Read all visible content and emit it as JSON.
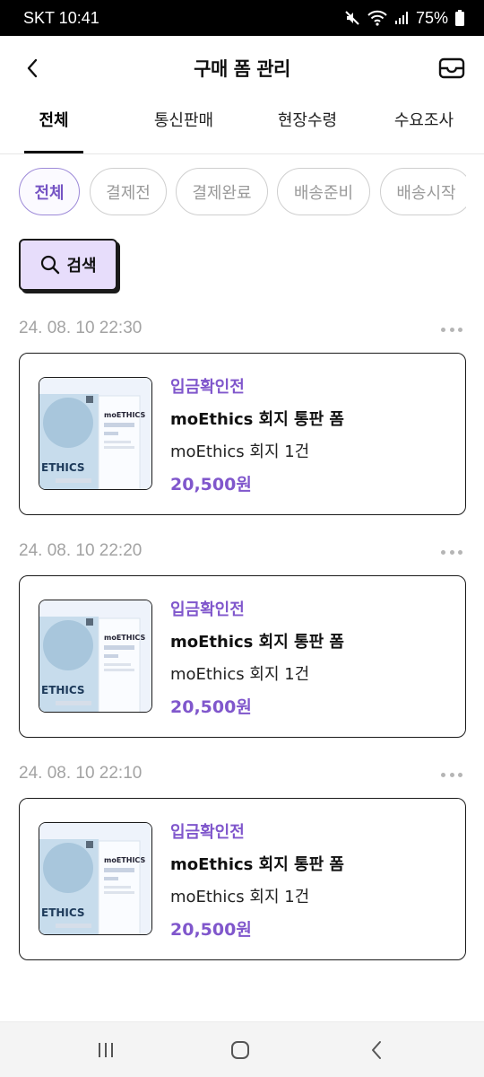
{
  "status_bar": {
    "carrier_time": "SKT 10:41",
    "battery": "75%"
  },
  "header": {
    "title": "구매 폼 관리"
  },
  "tabs": [
    {
      "label": "전체",
      "active": true
    },
    {
      "label": "통신판매",
      "active": false
    },
    {
      "label": "현장수령",
      "active": false
    },
    {
      "label": "수요조사",
      "active": false
    }
  ],
  "filters": [
    {
      "label": "전체",
      "active": true
    },
    {
      "label": "결제전",
      "active": false
    },
    {
      "label": "결제완료",
      "active": false
    },
    {
      "label": "배송준비",
      "active": false
    },
    {
      "label": "배송시작",
      "active": false
    }
  ],
  "search": {
    "label": "검색"
  },
  "orders": [
    {
      "time": "24. 08. 10 22:30",
      "status": "입금확인전",
      "title": "moEthics 회지 통판 폼",
      "item": "moEthics 회지 1건",
      "price": "20,500원"
    },
    {
      "time": "24. 08. 10 22:20",
      "status": "입금확인전",
      "title": "moEthics 회지 통판 폼",
      "item": "moEthics 회지 1건",
      "price": "20,500원"
    },
    {
      "time": "24. 08. 10 22:10",
      "status": "입금확인전",
      "title": "moEthics 회지 통판 폼",
      "item": "moEthics 회지 1건",
      "price": "20,500원"
    }
  ],
  "colors": {
    "accent": "#8057cc",
    "chip_active_border": "#9d8ad8",
    "search_bg": "#e7ddfb"
  },
  "icons": {
    "back": "chevron-left-icon",
    "inbox": "inbox-icon",
    "search": "search-icon",
    "more": "more-horizontal-icon",
    "book_cover": "book-cover-image"
  }
}
